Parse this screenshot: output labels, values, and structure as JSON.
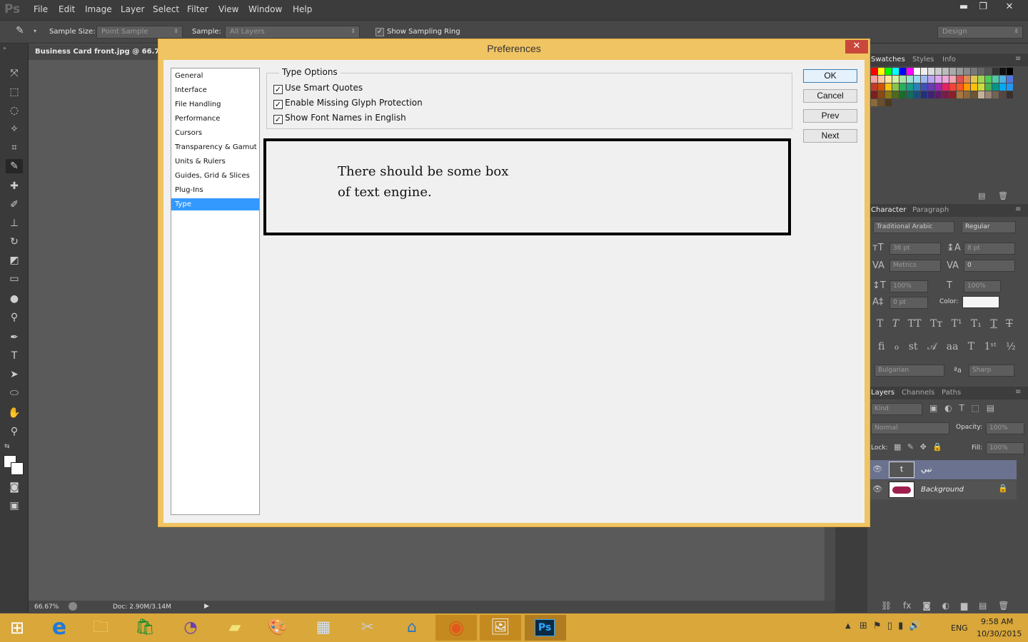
{
  "app": {
    "logo": "Ps"
  },
  "menu": [
    "File",
    "Edit",
    "Image",
    "Layer",
    "Select",
    "Filter",
    "View",
    "Window",
    "Help"
  ],
  "options_bar": {
    "sample_size_label": "Sample Size:",
    "sample_size_value": "Point Sample",
    "sample_label": "Sample:",
    "sample_value": "All Layers",
    "sampling_ring_label": "Show Sampling Ring",
    "workspace": "Design"
  },
  "document": {
    "tab_title": "Business Card front.jpg @ 66.7%",
    "zoom": "66.67%",
    "doc_size": "Doc: 2.90M/3.14M"
  },
  "dialog": {
    "title": "Preferences",
    "close": "✕",
    "categories": [
      "General",
      "Interface",
      "File Handling",
      "Performance",
      "Cursors",
      "Transparency & Gamut",
      "Units & Rulers",
      "Guides, Grid & Slices",
      "Plug-Ins",
      "Type"
    ],
    "selected_category": "Type",
    "group_title": "Type Options",
    "options": [
      {
        "label": "Use Smart Quotes",
        "checked": true
      },
      {
        "label": "Enable Missing Glyph Protection",
        "checked": true
      },
      {
        "label": "Show Font Names in English",
        "checked": true
      }
    ],
    "notice_line1": "There should be some box",
    "notice_line2": "of text engine.",
    "buttons": {
      "ok": "OK",
      "cancel": "Cancel",
      "prev": "Prev",
      "next": "Next"
    }
  },
  "panels": {
    "swatch_tabs": [
      "Swatches",
      "Styles",
      "Info"
    ],
    "char_tabs": [
      "Character",
      "Paragraph"
    ],
    "font_family": "Traditional Arabic",
    "font_style": "Regular",
    "font_size": "36 pt",
    "leading": "8 pt",
    "kerning": "Metrics",
    "tracking": "0",
    "vscale": "100%",
    "hscale": "100%",
    "baseline": "0 pt",
    "color_label": "Color:",
    "language": "Bulgarian",
    "antialias_symbol": "ªa",
    "antialias": "Sharp",
    "layer_tabs": [
      "Layers",
      "Channels",
      "Paths"
    ],
    "kind": "Kind",
    "blend": "Normal",
    "opacity_label": "Opacity:",
    "opacity": "100%",
    "lock_label": "Lock:",
    "fill_label": "Fill:",
    "fill": "100%",
    "layers": [
      "نبي",
      "Background"
    ]
  },
  "taskbar": {
    "time": "9:58 AM",
    "date": "10/30/2015",
    "lang": "ENG",
    "ps_label": "Ps"
  },
  "colors": {
    "dialog_frame": "#f0c463",
    "selection": "#3399ff",
    "taskbar": "#d9a73a",
    "ps_bg": "#535353"
  }
}
